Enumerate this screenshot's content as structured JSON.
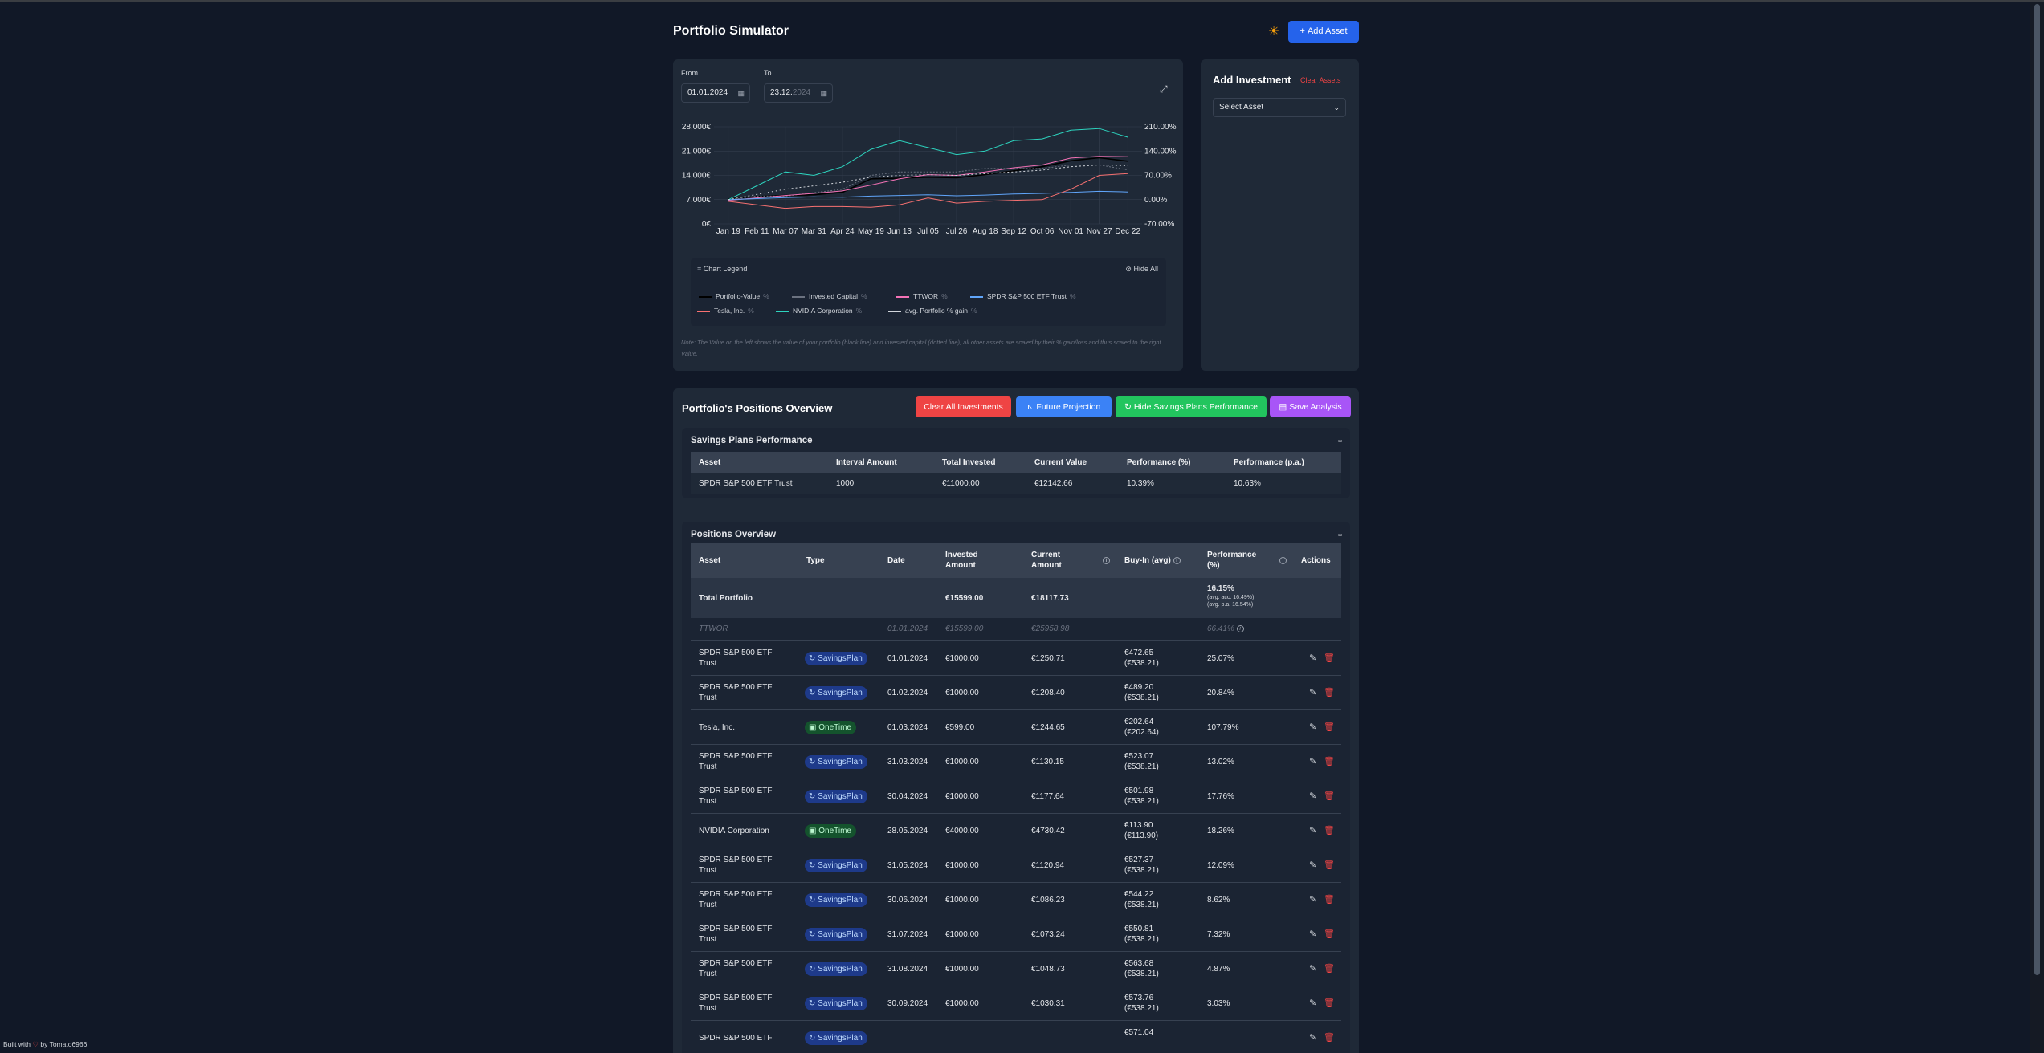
{
  "header": {
    "title": "Portfolio Simulator",
    "add_asset_label": "Add Asset",
    "theme_icon": "sun-icon"
  },
  "chart_panel": {
    "from_label": "From",
    "from_value": "01.01.2024",
    "to_label": "To",
    "to_value": "23.12.",
    "to_value_dim": "2024",
    "legend_title": "Chart Legend",
    "hide_all_label": "Hide All",
    "legend": [
      {
        "name": "Portfolio-Value",
        "color": "#000000"
      },
      {
        "name": "Invested Capital",
        "color": "#6b7280"
      },
      {
        "name": "TTWOR",
        "color": "#f472b6"
      },
      {
        "name": "SPDR S&P 500 ETF Trust",
        "color": "#60a5fa"
      },
      {
        "name": "Tesla, Inc.",
        "color": "#f87171"
      },
      {
        "name": "NVIDIA Corporation",
        "color": "#2dd4bf"
      },
      {
        "name": "avg. Portfolio % gain",
        "color": "#d1d5db"
      }
    ],
    "legend_pct": "%",
    "note": "Note: The Value on the left shows the value of your portfolio (black line) and invested capital (dotted line), all other assets are scaled by their % gain/loss and thus scaled to the right Value."
  },
  "chart_data": {
    "type": "line",
    "x": [
      "Jan 19",
      "Feb 11",
      "Mar 07",
      "Mar 31",
      "Apr 24",
      "May 19",
      "Jun 13",
      "Jul 05",
      "Jul 26",
      "Aug 18",
      "Sep 12",
      "Oct 06",
      "Nov 01",
      "Nov 27",
      "Dec 22"
    ],
    "y_left_ticks": [
      "28,000€",
      "21,000€",
      "14,000€",
      "7,000€",
      "0€"
    ],
    "y_right_ticks": [
      "210.00%",
      "140.00%",
      "70.00%",
      "0.00%",
      "-70.00%"
    ],
    "ylim_left": [
      0,
      28000
    ],
    "ylim_right": [
      -70,
      210
    ],
    "series": [
      {
        "name": "Portfolio-Value",
        "axis": "left",
        "values": [
          7200,
          7900,
          8200,
          8400,
          9100,
          13000,
          13200,
          13500,
          13300,
          14200,
          15300,
          16500,
          18200,
          19100,
          18100
        ]
      },
      {
        "name": "Invested Capital",
        "axis": "left",
        "values": [
          7000,
          8000,
          8000,
          9000,
          10000,
          14000,
          15000,
          15000,
          15000,
          16000,
          16000,
          16000,
          17000,
          17000,
          15599
        ]
      },
      {
        "name": "TTWOR",
        "axis": "right",
        "values": [
          -2,
          5,
          12,
          18,
          25,
          42,
          60,
          72,
          70,
          80,
          92,
          100,
          120,
          125,
          124
        ]
      },
      {
        "name": "SPDR S&P 500 ETF Trust",
        "axis": "right",
        "values": [
          0,
          3,
          6,
          8,
          7,
          10,
          12,
          14,
          11,
          13,
          16,
          18,
          21,
          24,
          22
        ]
      },
      {
        "name": "Tesla, Inc.",
        "axis": "right",
        "values": [
          -5,
          -15,
          -25,
          -20,
          -20,
          -22,
          -15,
          5,
          -10,
          -5,
          -2,
          0,
          30,
          70,
          75
        ]
      },
      {
        "name": "NVIDIA Corporation",
        "axis": "right",
        "values": [
          0,
          40,
          80,
          70,
          95,
          145,
          170,
          150,
          130,
          140,
          170,
          175,
          200,
          205,
          180
        ]
      },
      {
        "name": "avg. Portfolio % gain",
        "axis": "right",
        "values": [
          0,
          15,
          30,
          40,
          50,
          65,
          70,
          72,
          70,
          75,
          80,
          85,
          95,
          100,
          98
        ]
      }
    ]
  },
  "invest_panel": {
    "title": "Add Investment",
    "clear_label": "Clear Assets",
    "select_placeholder": "Select Asset"
  },
  "positions_panel": {
    "title_prefix": "Portfolio's ",
    "title_underlined": "Positions",
    "title_suffix": " Overview",
    "buttons": {
      "clear_all": "Clear All Investments",
      "future_projection": "Future Projection",
      "hide_savings": "Hide Savings Plans Performance",
      "save_analysis": "Save Analysis"
    }
  },
  "savings_table": {
    "title": "Savings Plans Performance",
    "headers": [
      "Asset",
      "Interval Amount",
      "Total Invested",
      "Current Value",
      "Performance (%)",
      "Performance (p.a.)"
    ],
    "rows": [
      [
        "SPDR S&P 500 ETF Trust",
        "1000",
        "€11000.00",
        "€12142.66",
        "10.39%",
        "10.63%"
      ]
    ]
  },
  "positions_table": {
    "title": "Positions Overview",
    "headers": {
      "asset": "Asset",
      "type": "Type",
      "date": "Date",
      "invested_1": "Invested",
      "invested_2": "Amount",
      "current_1": "Current",
      "current_2": "Amount",
      "buyin": "Buy-In (avg)",
      "perf_1": "Performance",
      "perf_2": "(%)",
      "actions": "Actions"
    },
    "total": {
      "asset": "Total Portfolio",
      "invested": "€15599.00",
      "current": "€18117.73",
      "perf": "16.15%",
      "perf_acc": "(avg. acc. 16.49%)",
      "perf_pa": "(avg. p.a. 16.54%)"
    },
    "benchmark": {
      "asset": "TTWOR",
      "date": "01.01.2024",
      "invested": "€15599.00",
      "current": "€25958.98",
      "perf": "66.41%"
    },
    "rows": [
      {
        "a1": "SPDR S&P 500 ETF",
        "a2": "Trust",
        "type": "SavingsPlan",
        "date": "01.01.2024",
        "inv": "€1000.00",
        "cur": "€1250.71",
        "b1": "€472.65",
        "b2": "(€538.21)",
        "perf": "25.07%"
      },
      {
        "a1": "SPDR S&P 500 ETF",
        "a2": "Trust",
        "type": "SavingsPlan",
        "date": "01.02.2024",
        "inv": "€1000.00",
        "cur": "€1208.40",
        "b1": "€489.20",
        "b2": "(€538.21)",
        "perf": "20.84%"
      },
      {
        "a1": "Tesla, Inc.",
        "a2": "",
        "type": "OneTime",
        "date": "01.03.2024",
        "inv": "€599.00",
        "cur": "€1244.65",
        "b1": "€202.64",
        "b2": "(€202.64)",
        "perf": "107.79%"
      },
      {
        "a1": "SPDR S&P 500 ETF",
        "a2": "Trust",
        "type": "SavingsPlan",
        "date": "31.03.2024",
        "inv": "€1000.00",
        "cur": "€1130.15",
        "b1": "€523.07",
        "b2": "(€538.21)",
        "perf": "13.02%"
      },
      {
        "a1": "SPDR S&P 500 ETF",
        "a2": "Trust",
        "type": "SavingsPlan",
        "date": "30.04.2024",
        "inv": "€1000.00",
        "cur": "€1177.64",
        "b1": "€501.98",
        "b2": "(€538.21)",
        "perf": "17.76%"
      },
      {
        "a1": "NVIDIA Corporation",
        "a2": "",
        "type": "OneTime",
        "date": "28.05.2024",
        "inv": "€4000.00",
        "cur": "€4730.42",
        "b1": "€113.90",
        "b2": "(€113.90)",
        "perf": "18.26%"
      },
      {
        "a1": "SPDR S&P 500 ETF",
        "a2": "Trust",
        "type": "SavingsPlan",
        "date": "31.05.2024",
        "inv": "€1000.00",
        "cur": "€1120.94",
        "b1": "€527.37",
        "b2": "(€538.21)",
        "perf": "12.09%"
      },
      {
        "a1": "SPDR S&P 500 ETF",
        "a2": "Trust",
        "type": "SavingsPlan",
        "date": "30.06.2024",
        "inv": "€1000.00",
        "cur": "€1086.23",
        "b1": "€544.22",
        "b2": "(€538.21)",
        "perf": "8.62%"
      },
      {
        "a1": "SPDR S&P 500 ETF",
        "a2": "Trust",
        "type": "SavingsPlan",
        "date": "31.07.2024",
        "inv": "€1000.00",
        "cur": "€1073.24",
        "b1": "€550.81",
        "b2": "(€538.21)",
        "perf": "7.32%"
      },
      {
        "a1": "SPDR S&P 500 ETF",
        "a2": "Trust",
        "type": "SavingsPlan",
        "date": "31.08.2024",
        "inv": "€1000.00",
        "cur": "€1048.73",
        "b1": "€563.68",
        "b2": "(€538.21)",
        "perf": "4.87%"
      },
      {
        "a1": "SPDR S&P 500 ETF",
        "a2": "Trust",
        "type": "SavingsPlan",
        "date": "30.09.2024",
        "inv": "€1000.00",
        "cur": "€1030.31",
        "b1": "€573.76",
        "b2": "(€538.21)",
        "perf": "3.03%"
      },
      {
        "a1": "SPDR S&P 500 ETF",
        "a2": "",
        "type": "SavingsPlan",
        "date": "",
        "inv": "",
        "cur": "",
        "b1": "€571.04",
        "b2": "",
        "perf": ""
      }
    ]
  },
  "footer": {
    "prefix": "Built with",
    "suffix": "by Tomato6966"
  }
}
